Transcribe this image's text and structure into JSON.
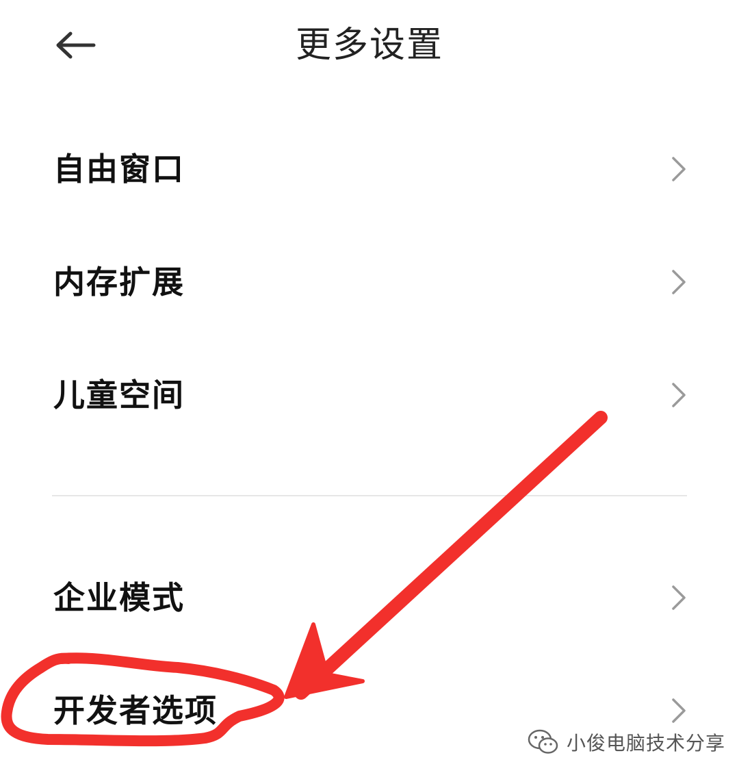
{
  "header": {
    "title": "更多设置",
    "back_icon": "arrow-left-icon"
  },
  "settings": {
    "items": [
      {
        "label": "自由窗口",
        "icon": "chevron-right-icon"
      },
      {
        "label": "内存扩展",
        "icon": "chevron-right-icon"
      },
      {
        "label": "儿童空间",
        "icon": "chevron-right-icon"
      },
      {
        "label": "企业模式",
        "icon": "chevron-right-icon"
      },
      {
        "label": "开发者选项",
        "icon": "chevron-right-icon"
      }
    ]
  },
  "annotation": {
    "color": "#f2302c",
    "target": "开发者选项"
  },
  "watermark": {
    "text": "小俊电脑技术分享",
    "icon": "wechat-icon"
  },
  "colors": {
    "chevron": "#9a9a9a",
    "divider": "#e6e6e6",
    "annotation_red": "#f2302c"
  }
}
